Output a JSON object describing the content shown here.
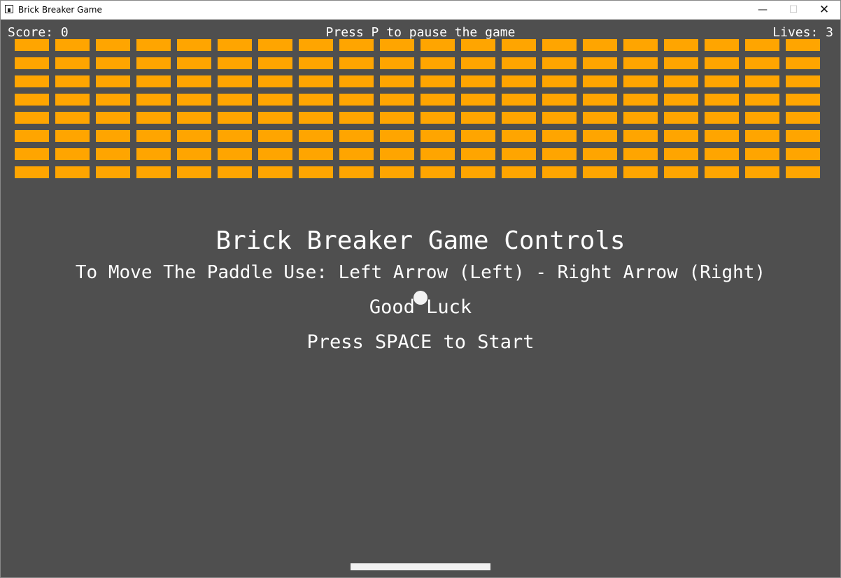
{
  "window": {
    "title": "Brick Breaker Game",
    "minimize_glyph": "—",
    "maximize_glyph": "☐",
    "close_glyph": "✕"
  },
  "hud": {
    "score_text": "Score: 0",
    "pause_hint": "Press P to pause the game",
    "lives_text": "Lives: 3"
  },
  "bricks": {
    "rows": 8,
    "columns": 20,
    "color": "#ffa500"
  },
  "controls": {
    "title": "Brick Breaker Game Controls",
    "move_hint": "To Move The Paddle Use: Left Arrow (Left) - Right Arrow (Right)",
    "good_luck": "Good Luck",
    "start_hint": "Press SPACE to Start"
  },
  "colors": {
    "background": "#4f4f4f",
    "text": "#ffffff",
    "ball": "#f2f2f2",
    "paddle": "#f2f2f2"
  }
}
